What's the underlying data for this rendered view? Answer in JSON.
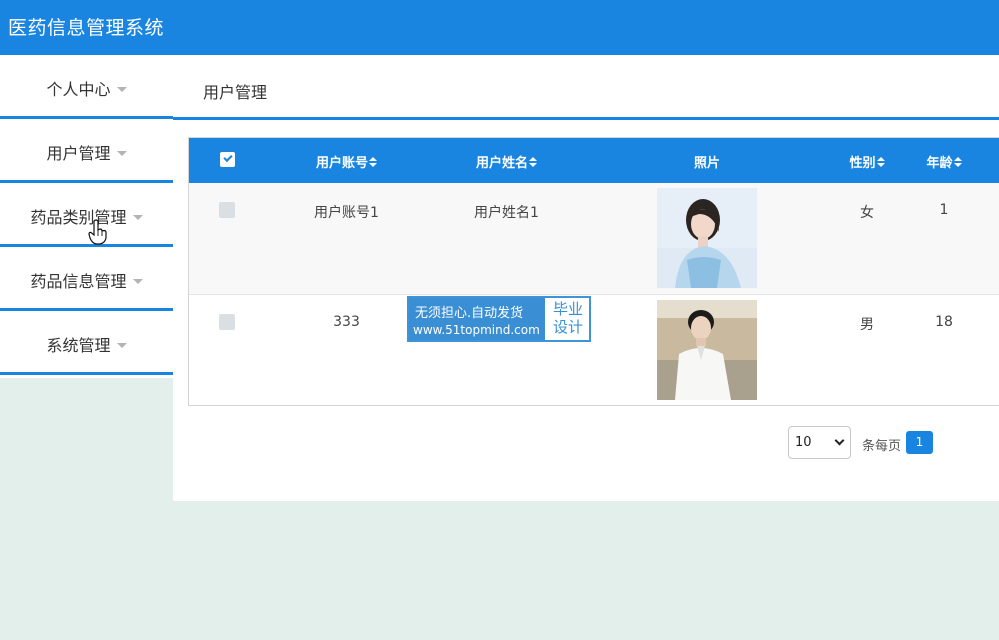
{
  "app": {
    "title": "医药信息管理系统"
  },
  "sidebar": {
    "items": [
      {
        "label": "个人中心"
      },
      {
        "label": "用户管理"
      },
      {
        "label": "药品类别管理"
      },
      {
        "label": "药品信息管理"
      },
      {
        "label": "系统管理"
      }
    ]
  },
  "breadcrumb": {
    "current": "用户管理"
  },
  "table": {
    "columns": [
      "用户账号",
      "用户姓名",
      "照片",
      "性别",
      "年龄"
    ],
    "rows": [
      {
        "account": "用户账号1",
        "name": "用户姓名1",
        "photo": "woman-portrait-photo",
        "gender": "女",
        "age": "1"
      },
      {
        "account": "333",
        "name": "",
        "photo": "man-portrait-photo",
        "gender": "男",
        "age": "18"
      }
    ]
  },
  "watermark": {
    "line1": "无须担心.自动发货",
    "line2": "www.51topmind.com",
    "badge_line1": "毕业",
    "badge_line2": "设计"
  },
  "pagination": {
    "page_size": "10",
    "per_page_label": "条每页",
    "current_page": "1"
  },
  "colors": {
    "primary": "#1a85e0",
    "background": "#e3efea"
  }
}
